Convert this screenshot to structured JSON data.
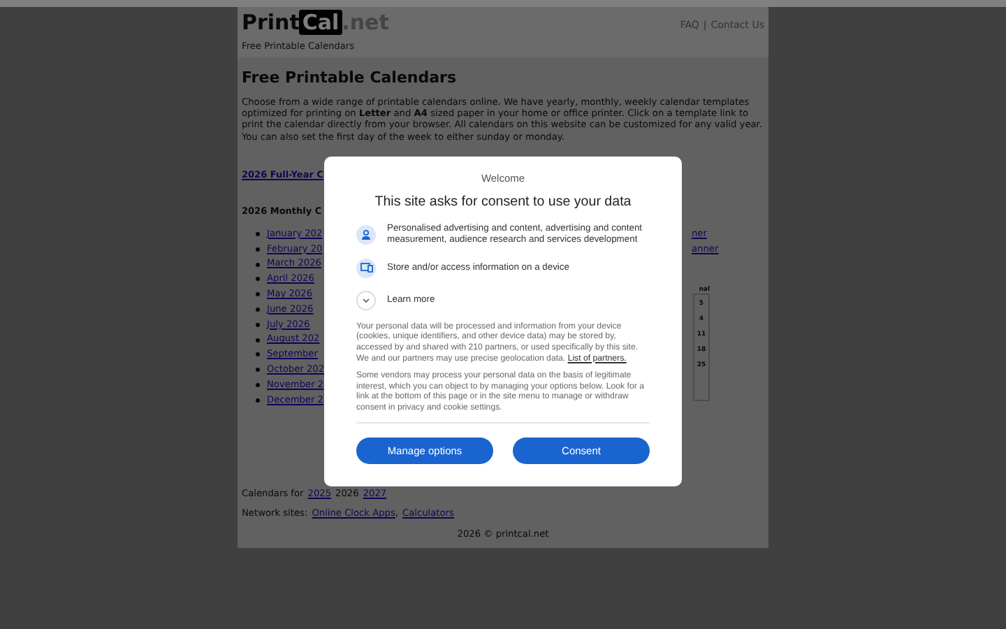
{
  "header": {
    "logo": [
      {
        "text": "Print",
        "kind": "plain"
      },
      {
        "text": "Cal",
        "kind": "inverted"
      },
      {
        "text": ".net",
        "kind": "muted"
      }
    ],
    "nav": [
      {
        "label": "FAQ"
      },
      {
        "label": "Contact Us"
      }
    ],
    "separator": "|",
    "tagline": "Free Printable Calendars"
  },
  "content": {
    "title": "Free Printable Calendars",
    "intro": "Choose from a wide range of printable calendars online. We have yearly, monthly, weekly calendar templates optimized for printing on **Letter** and **A4** sized paper in your home or office printer. Click on a template link to print the calendar directly from your browser. All calendars on this website can be customized for any valid year. You can also set the first day of the week to either sunday or monday.",
    "full_year_link": "2026 Full-Year C",
    "monthly_heading": "2026 Monthly C",
    "months": [
      "January 202",
      "February 20",
      "March 2026",
      "April 2026",
      "May 2026",
      "June 2026",
      "July 2026",
      "August 202",
      "September",
      "October 202",
      "November 2",
      "December 2"
    ],
    "side_links": [
      "ner",
      "anner"
    ],
    "mini_calendar": {
      "header": "nal",
      "cells": [
        "5",
        "4",
        "11",
        "18",
        "25"
      ]
    },
    "years": {
      "label": "Calendars for",
      "items": [
        {
          "text": "2025",
          "kind": "link"
        },
        {
          "text": "2026",
          "kind": "current"
        },
        {
          "text": "2027",
          "kind": "link"
        }
      ]
    },
    "network": {
      "label": "Network sites:",
      "links": [
        "Online Clock Apps",
        "Calculators"
      ],
      "separator": ","
    },
    "footer": "2026 © printcal.net"
  },
  "consent": {
    "welcome": "Welcome",
    "title": "This site asks for consent to use your data",
    "purposes": [
      {
        "kind": "person",
        "text": "Personalised advertising and content, advertising and content measurement, audience research and services development"
      },
      {
        "kind": "device",
        "text": "Store and/or access information on a device"
      }
    ],
    "learn_more": {
      "label": "Learn more",
      "expanded": false
    },
    "paragraph_1": "Your personal data will be processed and information from your device (cookies, unique identifiers, and other device data) may be stored by, accessed by and shared with 210 partners, or used specifically by this site. We and our partners may use precise geolocation data.",
    "partners_link": "List of partners.",
    "paragraph_2": "Some vendors may process your personal data on the basis of legitimate interest, which you can object to by managing your options below. Look for a link at the bottom of this page or in the site menu to manage or withdraw consent in privacy and cookie settings.",
    "buttons": [
      {
        "label": "Manage options"
      },
      {
        "label": "Consent"
      }
    ]
  }
}
